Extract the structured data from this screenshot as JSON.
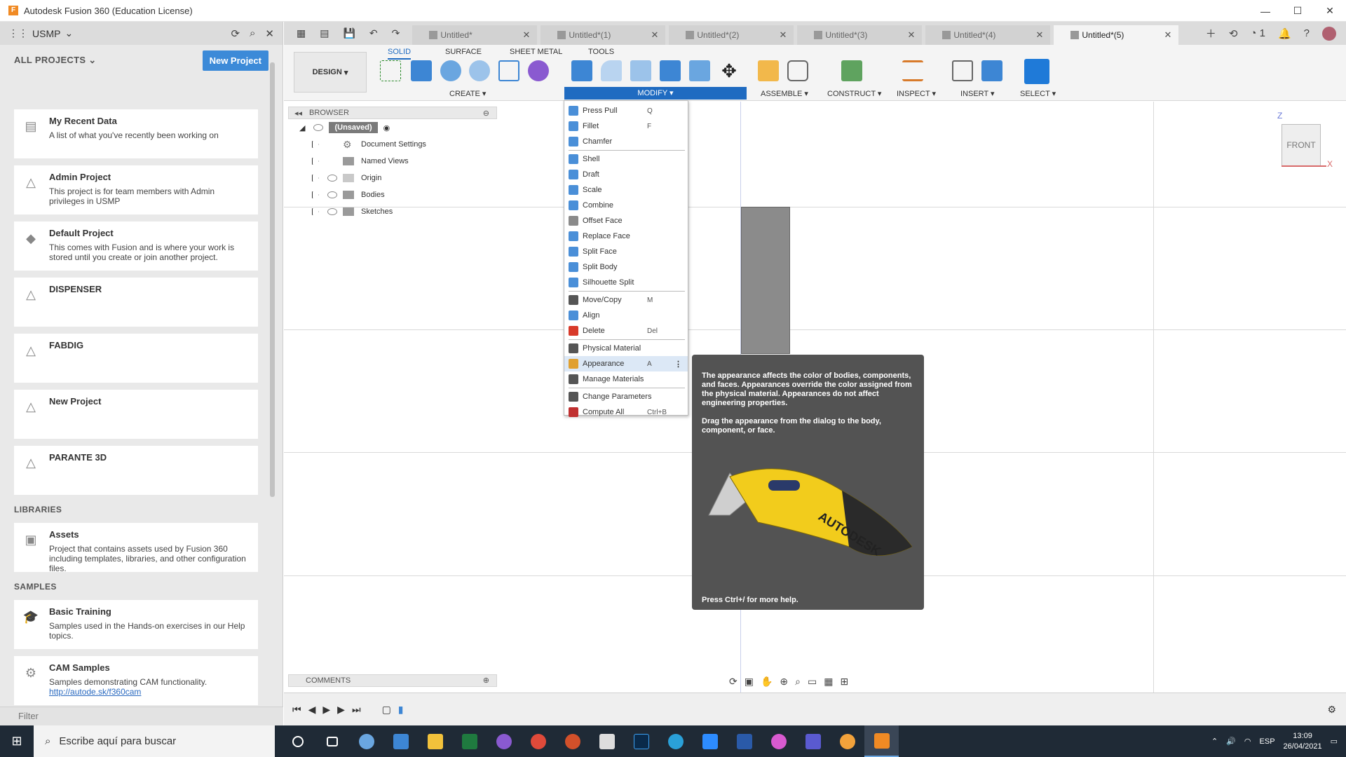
{
  "window": {
    "title": "Autodesk Fusion 360 (Education License)",
    "logo_letter": "F"
  },
  "data_panel": {
    "hub_name": "USMP",
    "all_projects_label": "ALL PROJECTS",
    "new_project_button": "New Project",
    "projects": [
      {
        "name": "My Recent Data",
        "desc": "A list of what you've recently been working on"
      },
      {
        "name": "Admin Project",
        "desc": "This project is for team members with Admin privileges in USMP"
      },
      {
        "name": "Default Project",
        "desc": "This comes with Fusion and is where your work is stored until you create or join another project."
      },
      {
        "name": "DISPENSER",
        "desc": ""
      },
      {
        "name": "FABDIG",
        "desc": ""
      },
      {
        "name": "New Project",
        "desc": ""
      },
      {
        "name": "PARANTE 3D",
        "desc": ""
      }
    ],
    "libraries_label": "LIBRARIES",
    "libraries": [
      {
        "name": "Assets",
        "desc": "Project that contains assets used by Fusion 360 including templates, libraries, and other configuration files."
      }
    ],
    "samples_label": "SAMPLES",
    "samples": [
      {
        "name": "Basic Training",
        "desc": "Samples used in the Hands-on exercises in our Help topics."
      },
      {
        "name": "CAM Samples",
        "desc": "Samples demonstrating CAM functionality.",
        "link": "http://autode.sk/f360cam"
      }
    ],
    "filter_placeholder": "Filter"
  },
  "tabs": [
    {
      "label": "Untitled*",
      "active": false
    },
    {
      "label": "Untitled*(1)",
      "active": false
    },
    {
      "label": "Untitled*(2)",
      "active": false
    },
    {
      "label": "Untitled*(3)",
      "active": false
    },
    {
      "label": "Untitled*(4)",
      "active": false
    },
    {
      "label": "Untitled*(5)",
      "active": true
    }
  ],
  "notification_count": "1",
  "ribbon": {
    "workspace": "DESIGN",
    "tabs": [
      "SOLID",
      "SURFACE",
      "SHEET METAL",
      "TOOLS"
    ],
    "groups": [
      "CREATE",
      "MODIFY",
      "ASSEMBLE",
      "CONSTRUCT",
      "INSPECT",
      "INSERT",
      "SELECT"
    ]
  },
  "browser": {
    "header": "BROWSER",
    "root": "(Unsaved)",
    "items": [
      "Document Settings",
      "Named Views",
      "Origin",
      "Bodies",
      "Sketches"
    ]
  },
  "modify_menu": {
    "groups": [
      [
        {
          "label": "Press Pull",
          "shortcut": "Q",
          "icon_color": "#4a8fd8"
        },
        {
          "label": "Fillet",
          "shortcut": "F",
          "icon_color": "#4a8fd8"
        },
        {
          "label": "Chamfer",
          "shortcut": "",
          "icon_color": "#4a8fd8"
        }
      ],
      [
        {
          "label": "Shell",
          "shortcut": "",
          "icon_color": "#4a8fd8"
        },
        {
          "label": "Draft",
          "shortcut": "",
          "icon_color": "#4a8fd8"
        },
        {
          "label": "Scale",
          "shortcut": "",
          "icon_color": "#4a8fd8"
        },
        {
          "label": "Combine",
          "shortcut": "",
          "icon_color": "#4a8fd8"
        },
        {
          "label": "Offset Face",
          "shortcut": "",
          "icon_color": "#8a8a8a"
        },
        {
          "label": "Replace Face",
          "shortcut": "",
          "icon_color": "#4a8fd8"
        },
        {
          "label": "Split Face",
          "shortcut": "",
          "icon_color": "#4a8fd8"
        },
        {
          "label": "Split Body",
          "shortcut": "",
          "icon_color": "#4a8fd8"
        },
        {
          "label": "Silhouette Split",
          "shortcut": "",
          "icon_color": "#4a8fd8"
        }
      ],
      [
        {
          "label": "Move/Copy",
          "shortcut": "M",
          "icon_color": "#555555"
        },
        {
          "label": "Align",
          "shortcut": "",
          "icon_color": "#4a8fd8"
        },
        {
          "label": "Delete",
          "shortcut": "Del",
          "icon_color": "#d83a2a"
        }
      ],
      [
        {
          "label": "Physical Material",
          "shortcut": "",
          "icon_color": "#555555"
        },
        {
          "label": "Appearance",
          "shortcut": "A",
          "icon_color": "#e0a030"
        },
        {
          "label": "Manage Materials",
          "shortcut": "",
          "icon_color": "#555555"
        }
      ],
      [
        {
          "label": "Change Parameters",
          "shortcut": "",
          "icon_color": "#555555"
        },
        {
          "label": "Compute All",
          "shortcut": "Ctrl+B",
          "icon_color": "#c03030"
        }
      ]
    ]
  },
  "tooltip": {
    "para1": "The appearance affects the color of bodies, components, and faces. Appearances override the color assigned from the physical material. Appearances do not affect engineering properties.",
    "para2": "Drag the appearance from the dialog to the body, component, or face.",
    "brand": "AUTODESK",
    "help": "Press Ctrl+/ for more help."
  },
  "viewcube": {
    "face": "FRONT",
    "z": "Z",
    "x": "X"
  },
  "comments_label": "COMMENTS",
  "taskbar": {
    "search_placeholder": "Escribe aquí para buscar",
    "lang": "ESP",
    "time": "13:09",
    "date": "26/04/2021"
  },
  "colors": {
    "accent": "#1f6bc1",
    "new_project_btn": "#3c8ad8",
    "tooltip_bg": "#535353",
    "taskbar_bg": "#1f2a36"
  }
}
